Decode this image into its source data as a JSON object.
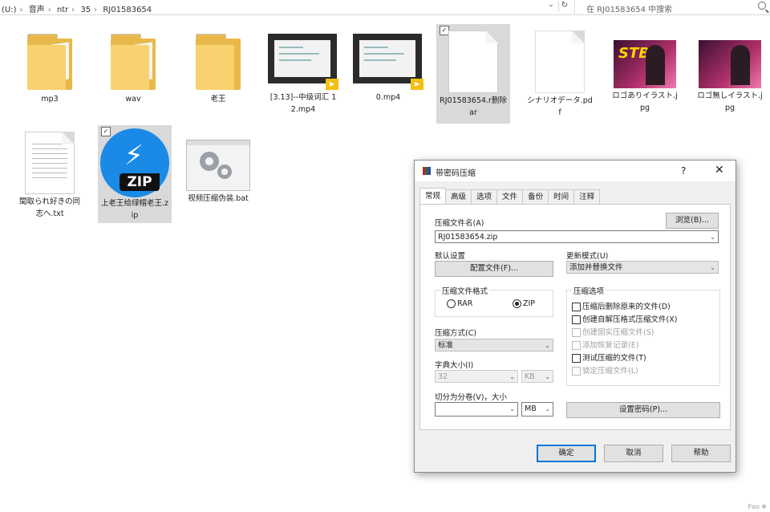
{
  "address_bar": {
    "crumbs": [
      "(U:)",
      "音声",
      "ntr",
      "35",
      "RJ01583654"
    ],
    "search_placeholder": "在 RJ01583654 中搜索"
  },
  "files": [
    {
      "name": "mp3",
      "type": "folder"
    },
    {
      "name": "wav",
      "type": "folder"
    },
    {
      "name": "老王",
      "type": "folder"
    },
    {
      "name": "[3.13]--中级词汇 12.mp4",
      "type": "video"
    },
    {
      "name": "0.mp4",
      "type": "video"
    },
    {
      "name": "RJ01583654.r删除ar",
      "type": "document",
      "checked": true
    },
    {
      "name": "シナリオデータ.pdf",
      "type": "document"
    },
    {
      "name": "ロゴありイラスト.jpg",
      "type": "image",
      "thumb_text": "STB"
    },
    {
      "name": "ロゴ無しイラスト.jpg",
      "type": "image"
    },
    {
      "name": "聞取られ好きの同志へ.txt",
      "type": "text"
    },
    {
      "name": "上老王给绿帽老王.zip",
      "type": "zip",
      "checked": true,
      "icon_text": "ZIP"
    },
    {
      "name": "视频压缩伪装.bat",
      "type": "batch"
    }
  ],
  "dialog": {
    "title": "带密码压缩",
    "help": "?",
    "close": "✕",
    "tabs": [
      "常规",
      "高级",
      "选项",
      "文件",
      "备份",
      "时间",
      "注释"
    ],
    "active_tab": "常规",
    "archive_name_label": "压缩文件名(A)",
    "browse_button": "浏览(B)...",
    "archive_name_value": "RJ01583654.zip",
    "default_settings_label": "默认设置",
    "profiles_button": "配置文件(F)...",
    "update_mode_label": "更新模式(U)",
    "update_mode_value": "添加并替换文件",
    "format_group_label": "压缩文件格式",
    "format_rar": "RAR",
    "format_zip": "ZIP",
    "format_selected": "ZIP",
    "options_group_label": "压缩选项",
    "options": [
      {
        "label": "压缩后删除原来的文件(D)",
        "enabled": true
      },
      {
        "label": "创建自解压格式压缩文件(X)",
        "enabled": true
      },
      {
        "label": "创建固实压缩文件(S)",
        "enabled": false
      },
      {
        "label": "添加恢复记录(E)",
        "enabled": false
      },
      {
        "label": "测试压缩的文件(T)",
        "enabled": true
      },
      {
        "label": "锁定压缩文件(L)",
        "enabled": false
      }
    ],
    "method_label": "压缩方式(C)",
    "method_value": "标准",
    "dict_label": "字典大小(I)",
    "dict_value": "32",
    "dict_unit": "KB",
    "split_label": "切分为分卷(V)，大小",
    "split_value": "",
    "split_unit": "MB",
    "password_button": "设置密码(P)...",
    "ok_button": "确定",
    "cancel_button": "取消",
    "help_button": "帮助"
  },
  "corner_text": "Foo ❄"
}
